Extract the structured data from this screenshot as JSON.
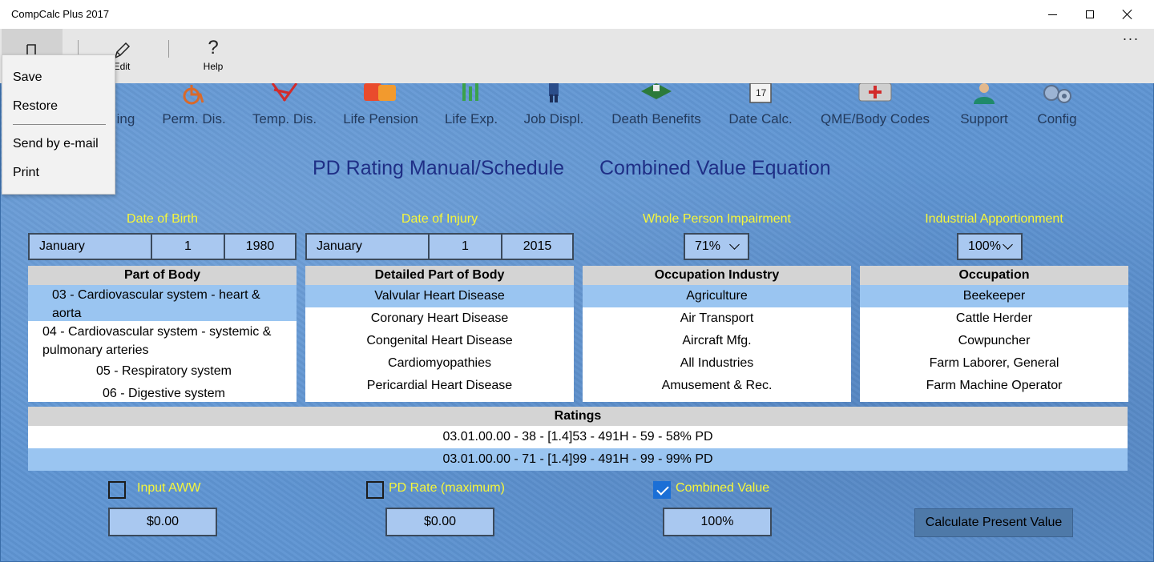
{
  "window": {
    "title": "CompCalc Plus 2017"
  },
  "commandbar": {
    "edit_label": "Edit",
    "help_label": "Help",
    "help_glyph": "?",
    "more_glyph": "···"
  },
  "file_menu": {
    "items": [
      "Save",
      "Restore",
      "Send by e-mail",
      "Print"
    ]
  },
  "nav": {
    "items": [
      {
        "label": "ing",
        "icon": "clipped-icon"
      },
      {
        "label": "Perm. Dis.",
        "icon": "wheelchair-icon"
      },
      {
        "label": "Temp. Dis.",
        "icon": "crutches-icon"
      },
      {
        "label": "Life Pension",
        "icon": "pension-icon"
      },
      {
        "label": "Life Exp.",
        "icon": "life-expectancy-icon"
      },
      {
        "label": "Job Displ.",
        "icon": "worker-icon"
      },
      {
        "label": "Death Benefits",
        "icon": "death-benefits-icon"
      },
      {
        "label": "Date Calc.",
        "icon": "calendar-icon"
      },
      {
        "label": "QME/Body Codes",
        "icon": "first-aid-kit-icon"
      },
      {
        "label": "Support",
        "icon": "support-person-icon"
      },
      {
        "label": "Config",
        "icon": "gears-icon"
      }
    ]
  },
  "headings": {
    "left": "PD Rating Manual/Schedule",
    "right": "Combined Value Equation"
  },
  "fields": {
    "dob_label": "Date of Birth",
    "doi_label": "Date of Injury",
    "wpi_label": "Whole Person Impairment",
    "ia_label": "Industrial Apportionment",
    "dob": {
      "month": "January",
      "day": "1",
      "year": "1980"
    },
    "doi": {
      "month": "January",
      "day": "1",
      "year": "2015"
    },
    "wpi_value": "71%",
    "ia_value": "100%"
  },
  "lists": {
    "part_of_body": {
      "header": "Part of Body",
      "items": [
        "03 - Cardiovascular system - heart & aorta",
        "04 - Cardiovascular system - systemic & pulmonary arteries",
        "05 - Respiratory system",
        "06 - Digestive system"
      ]
    },
    "detailed_part": {
      "header": "Detailed Part of Body",
      "items": [
        "Valvular Heart Disease",
        "Coronary Heart Disease",
        "Congenital Heart Disease",
        "Cardiomyopathies",
        "Pericardial Heart Disease"
      ]
    },
    "industry": {
      "header": "Occupation Industry",
      "items": [
        "Agriculture",
        "Air Transport",
        "Aircraft Mfg.",
        "All Industries",
        "Amusement & Rec."
      ]
    },
    "occupation": {
      "header": "Occupation",
      "items": [
        "Beekeeper",
        "Cattle Herder",
        "Cowpuncher",
        "Farm Laborer, General",
        "Farm Machine Operator"
      ]
    }
  },
  "ratings": {
    "header": "Ratings",
    "rows": [
      "03.01.00.00 - 38 - [1.4]53 - 491H - 59 - 58% PD",
      "03.01.00.00 - 71 - [1.4]99 - 491H - 99 - 99% PD"
    ]
  },
  "options": {
    "input_aww": {
      "label": "Input AWW",
      "checked": false,
      "value": "$0.00"
    },
    "pd_rate": {
      "label": "PD Rate (maximum)",
      "checked": false,
      "value": "$0.00"
    },
    "combined_value": {
      "label": "Combined Value",
      "checked": true,
      "value": "100%"
    }
  },
  "calc_button": "Calculate Present Value",
  "colors": {
    "background": "#5f95d3",
    "field_label": "#f6f63a",
    "selected_row": "#9ac5f1",
    "heading": "#1f2f86"
  }
}
